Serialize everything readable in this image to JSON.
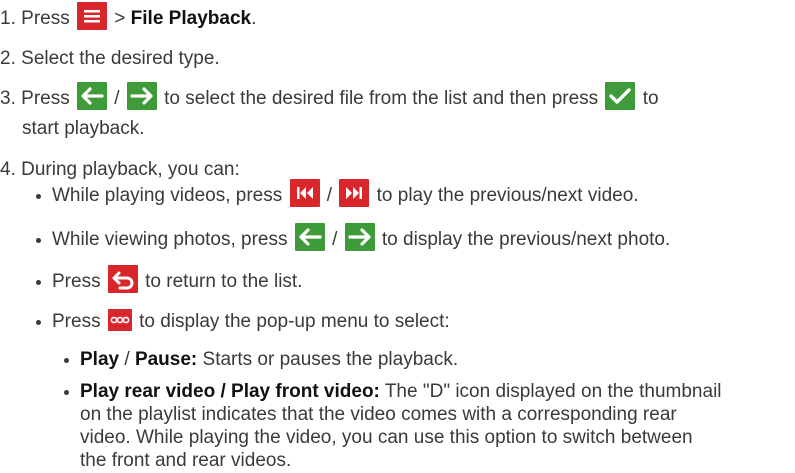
{
  "steps": {
    "s1": {
      "num": "1.",
      "pre": "Press",
      "gt": ">",
      "bold": "File Playback",
      "post": "."
    },
    "s2": {
      "num": "2.",
      "text": "Select the desired type."
    },
    "s3": {
      "num": "3.",
      "pre": "Press",
      "slash": "/",
      "mid": "to select the desired file from the list and then press",
      "post": "to",
      "cont": "start playback."
    },
    "s4": {
      "num": "4.",
      "text": "During playback, you can:"
    }
  },
  "bullets": {
    "b1": {
      "pre": "While playing videos, press",
      "slash": "/",
      "post": "to play the previous/next video."
    },
    "b2": {
      "pre": "While viewing photos, press",
      "slash": "/",
      "post": "to display the previous/next photo."
    },
    "b3": {
      "pre": "Press",
      "post": "to return to the list."
    },
    "b4": {
      "pre": "Press",
      "post": "to display the pop-up menu to select:"
    }
  },
  "sub": {
    "i1": {
      "bold1": "Play",
      "slash": "/",
      "bold2": "Pause:",
      "text": "Starts or pauses the playback."
    },
    "i2": {
      "bold": "Play rear video / Play front video:",
      "l1": "The \"D\" icon displayed on the thumbnail",
      "l2": "on the playlist indicates that the video comes with a corresponding rear",
      "l3": "video. While playing the video, you can use this option to switch between",
      "l4": "the front and rear videos."
    }
  },
  "icons": {
    "menu": "menu-icon",
    "left": "arrow-left-icon",
    "right": "arrow-right-icon",
    "check": "checkmark-icon",
    "prev": "skip-previous-icon",
    "next": "skip-next-icon",
    "back": "return-icon",
    "more": "more-options-icon"
  },
  "colors": {
    "icon_red": "#d8262b",
    "icon_green": "#3f9b3a",
    "text": "#3a3a3a"
  }
}
